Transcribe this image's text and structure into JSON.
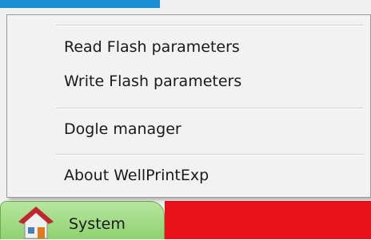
{
  "menu": {
    "items": [
      {
        "label": "Read Flash parameters"
      },
      {
        "label": "Write Flash parameters"
      },
      {
        "label": "Dogle manager"
      },
      {
        "label": "About WellPrintExp"
      }
    ]
  },
  "taskbar": {
    "system_tab_label": "System",
    "system_tab_icon": "house-icon",
    "tab_color": "#8fd16f",
    "alert_color": "#e8121c"
  },
  "accent_color": "#1a8fd6"
}
